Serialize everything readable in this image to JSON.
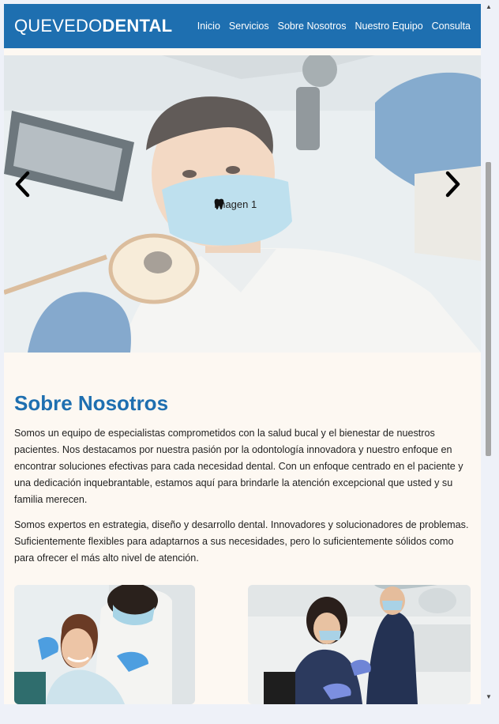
{
  "navbar": {
    "brand_light": "QUEVEDO",
    "brand_bold": "DENTAL",
    "links": [
      "Inicio",
      "Servicios",
      "Sobre Nosotros",
      "Nuestro Equipo",
      "Consulta"
    ]
  },
  "carousel": {
    "caption": "Imagen 1",
    "icon": "tooth-icon",
    "prev_icon": "chevron-left-icon",
    "next_icon": "chevron-right-icon"
  },
  "about": {
    "title": "Sobre Nosotros",
    "paragraph1": "Somos un equipo de especialistas comprometidos con la salud bucal y el bienestar de nuestros pacientes. Nos destacamos por nuestra pasión por la odontología innovadora y nuestro enfoque en encontrar soluciones efectivas para cada necesidad dental. Con un enfoque centrado en el paciente y una dedicación inquebrantable, estamos aquí para brindarle la atención excepcional que usted y su familia merecen.",
    "paragraph2": "Somos expertos en estrategia, diseño y desarrollo dental. Innovadores y solucionadores de problemas. Suficientemente flexibles para adaptarnos a sus necesidades, pero lo suficientemente sólidos como para ofrecer el más alto nivel de atención."
  },
  "colors": {
    "primary": "#1e6fb0",
    "page_background": "#fdf8f2",
    "outer_background": "#eef1f8"
  }
}
